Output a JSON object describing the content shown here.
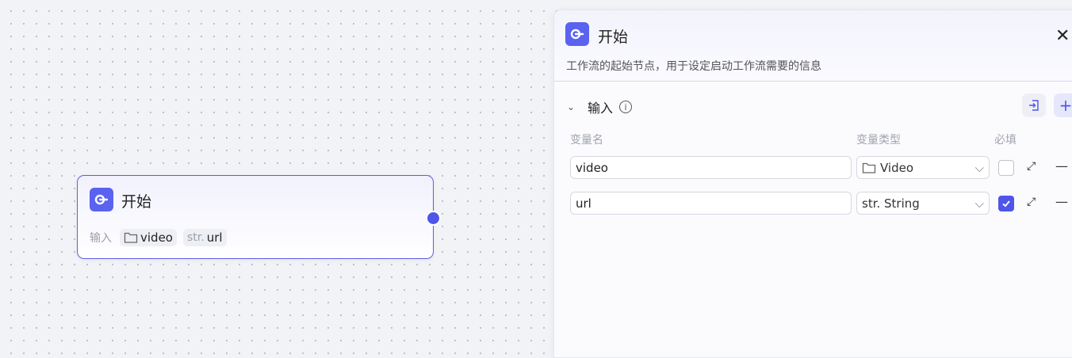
{
  "node": {
    "title": "开始",
    "inputs_label": "输入",
    "vars": [
      {
        "name": "video",
        "type_icon": "folder-icon"
      },
      {
        "prefix": "str.",
        "name": "url"
      }
    ]
  },
  "panel": {
    "title": "开始",
    "description": "工作流的起始节点，用于设定启动工作流需要的信息",
    "section": "输入",
    "columns": {
      "name": "变量名",
      "type": "变量类型",
      "required": "必填"
    },
    "rows": [
      {
        "name": "video",
        "type": "Video",
        "type_icon": "folder-icon",
        "required": false
      },
      {
        "name": "url",
        "type": "str. String",
        "required": true
      }
    ]
  },
  "colors": {
    "accent": "#4f55e8"
  }
}
